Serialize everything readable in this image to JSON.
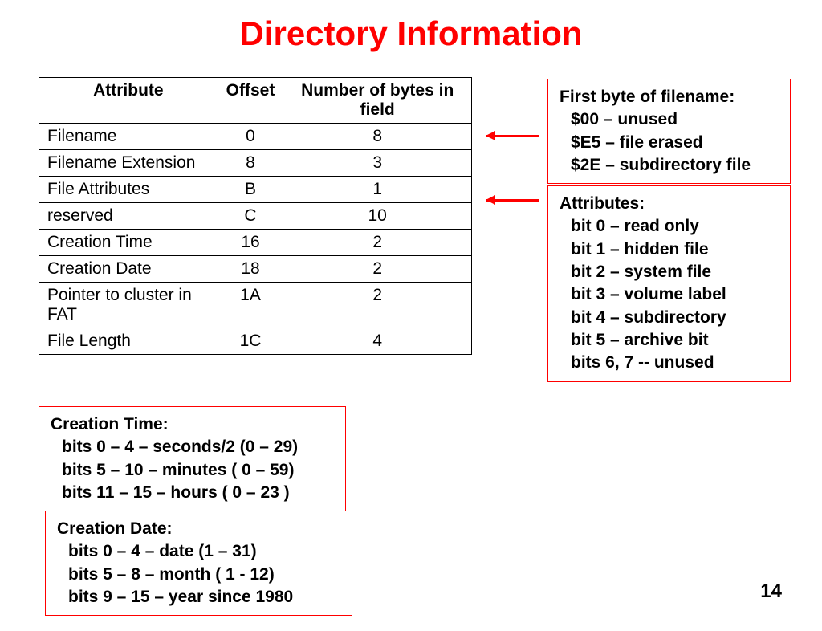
{
  "title": "Directory Information",
  "page_number": "14",
  "chart_data": {
    "type": "table",
    "columns": [
      "Attribute",
      "Offset",
      "Number of bytes in field"
    ],
    "rows": [
      {
        "attr": "Filename",
        "offset": "0",
        "bytes": "8"
      },
      {
        "attr": "Filename Extension",
        "offset": "8",
        "bytes": "3"
      },
      {
        "attr": "File Attributes",
        "offset": "B",
        "bytes": "1"
      },
      {
        "attr": "reserved",
        "offset": "C",
        "bytes": "10"
      },
      {
        "attr": "Creation Time",
        "offset": "16",
        "bytes": "2"
      },
      {
        "attr": "Creation Date",
        "offset": "18",
        "bytes": "2"
      },
      {
        "attr": "Pointer to cluster in FAT",
        "offset": "1A",
        "bytes": "2"
      },
      {
        "attr": "File Length",
        "offset": "1C",
        "bytes": "4"
      }
    ]
  },
  "box_firstbyte": {
    "head": "First byte of filename:",
    "items": [
      "$00 – unused",
      "$E5 – file erased",
      "$2E – subdirectory file"
    ]
  },
  "box_attributes": {
    "head": "Attributes:",
    "items": [
      "bit 0 – read only",
      "bit 1 – hidden file",
      "bit 2 – system file",
      "bit 3 – volume label",
      "bit 4 – subdirectory",
      "bit 5 – archive bit",
      "bits 6, 7 -- unused"
    ]
  },
  "box_ctime": {
    "head": "Creation Time:",
    "items": [
      "bits 0 – 4 – seconds/2 (0 – 29)",
      "bits 5 – 10 – minutes ( 0 – 59)",
      "bits 11 – 15 – hours ( 0 – 23 )"
    ]
  },
  "box_cdate": {
    "head": "Creation Date:",
    "items": [
      "bits 0 – 4 – date (1 – 31)",
      "bits 5 – 8 – month ( 1 - 12)",
      "bits 9 – 15 – year since 1980"
    ]
  }
}
